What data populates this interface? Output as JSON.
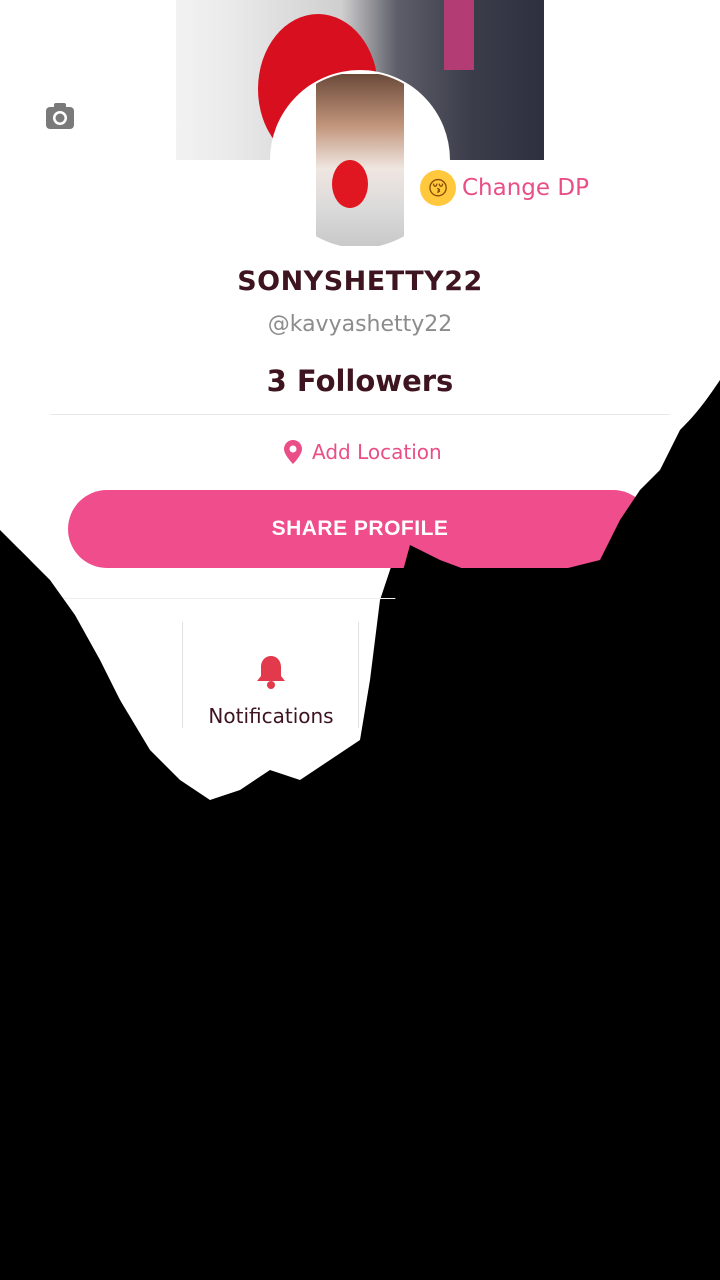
{
  "profile": {
    "display_name": "SONYSHETTY22",
    "handle": "@kavyashetty22",
    "followers_label": "3 Followers",
    "change_dp_label": "Change DP",
    "change_dp_emoji": "😚",
    "location_label": "Add Location"
  },
  "actions": {
    "share_label": "SHARE PROFILE"
  },
  "tiles": [
    {
      "label": "",
      "icon": "camera-icon"
    },
    {
      "label": "Notifications",
      "icon": "bell-icon"
    }
  ],
  "colors": {
    "accent": "#ef4d8b",
    "text_dark": "#3d1420",
    "icon_red": "#e23a4c"
  }
}
